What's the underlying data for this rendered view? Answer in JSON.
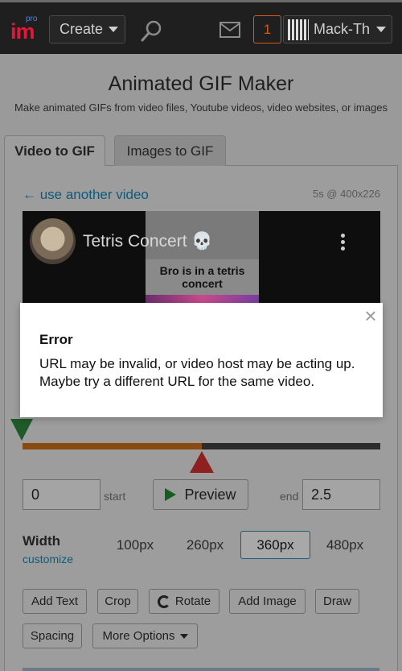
{
  "header": {
    "logo_main": "im",
    "logo_sub": "pro",
    "create_label": "Create",
    "notification_count": "1",
    "username": "Mack-The",
    "icons": [
      "search-icon",
      "mail-icon",
      "chevron-down-icon"
    ]
  },
  "page": {
    "title": "Animated GIF Maker",
    "subtitle": "Make animated GIFs from video files, Youtube videos, video websites, or images"
  },
  "tabs": [
    {
      "label": "Video to GIF",
      "active": true
    },
    {
      "label": "Images to GIF",
      "active": false
    }
  ],
  "video": {
    "back_link": "← use another video",
    "meta": "5s @ 400x226",
    "title": "Tetris Concert 💀",
    "thumb_caption": "Bro is in a tetris concert"
  },
  "trim": {
    "start_value": "0",
    "start_label": "start",
    "preview_label": "Preview",
    "end_label": "end",
    "end_value": "2.5",
    "selected_fraction": 0.5
  },
  "width": {
    "label": "Width",
    "customize_label": "customize",
    "options": [
      "100px",
      "260px",
      "360px",
      "480px"
    ],
    "selected": "360px"
  },
  "tools": {
    "add_text": "Add Text",
    "crop": "Crop",
    "rotate": "Rotate",
    "add_image": "Add Image",
    "draw": "Draw",
    "spacing": "Spacing",
    "more_options": "More Options"
  },
  "modal": {
    "title": "Error",
    "message": "URL may be invalid, or video host may be acting up. Maybe try a different URL for the same video.",
    "close_symbol": "×"
  },
  "colors": {
    "header_bg": "#1f1f1f",
    "overlay": "#9a9a9a",
    "link": "#0f5b7a",
    "notification": "#d55a13",
    "logo": "#e2173a"
  }
}
